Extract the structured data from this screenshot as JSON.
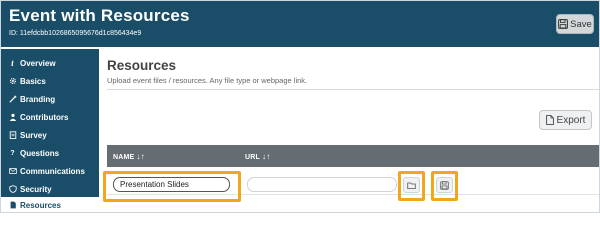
{
  "header": {
    "title": "Event with Resources",
    "id_text": "ID: 11efdcbb1026865095676d1c856434e9",
    "save_label": "Save"
  },
  "sidebar": {
    "items": [
      {
        "label": "Overview",
        "icon": "info-icon"
      },
      {
        "label": "Basics",
        "icon": "gear-icon"
      },
      {
        "label": "Branding",
        "icon": "brush-icon"
      },
      {
        "label": "Contributors",
        "icon": "person-icon"
      },
      {
        "label": "Survey",
        "icon": "clipboard-icon"
      },
      {
        "label": "Questions",
        "icon": "question-icon"
      },
      {
        "label": "Communications",
        "icon": "envelope-icon"
      },
      {
        "label": "Security",
        "icon": "shield-icon"
      },
      {
        "label": "Resources",
        "icon": "document-icon",
        "active": true
      }
    ]
  },
  "main": {
    "title": "Resources",
    "description": "Upload event files / resources. Any file type or webpage link.",
    "export_label": "Export",
    "table": {
      "columns": [
        {
          "label": "NAME",
          "sort": "↓↑"
        },
        {
          "label": "URL",
          "sort": "↓↑"
        }
      ],
      "rows": [
        {
          "name": "Presentation Slides",
          "url": ""
        }
      ]
    }
  },
  "colors": {
    "brand": "#1a4e68",
    "highlight": "#f2a71b",
    "table_header": "#666d72"
  }
}
